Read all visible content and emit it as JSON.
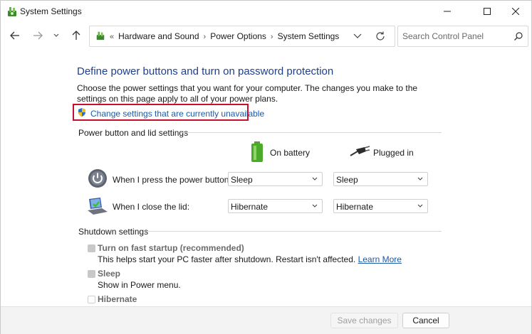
{
  "window": {
    "title": "System Settings"
  },
  "titlebar_icons": {
    "app": "control-panel-icon",
    "minimize": "minimize-icon",
    "maximize": "maximize-icon",
    "close": "close-icon"
  },
  "navigation": {
    "back_icon": "arrow-left-icon",
    "forward_icon": "arrow-right-icon",
    "recent_icon": "chevron-down-icon",
    "up_icon": "arrow-up-icon",
    "breadcrumbs": [
      "Hardware and Sound",
      "Power Options",
      "System Settings"
    ],
    "overflow": "«",
    "search_placeholder": "Search Control Panel"
  },
  "page": {
    "heading": "Define power buttons and turn on password protection",
    "description": "Choose the power settings that you want for your computer. The changes you make to the settings on this page apply to all of your power plans.",
    "change_link": "Change settings that are currently unavailable"
  },
  "power_button_section": {
    "label": "Power button and lid settings",
    "columns": [
      "On battery",
      "Plugged in"
    ],
    "rows": [
      {
        "label": "When I press the power button:",
        "on_battery": "Sleep",
        "plugged_in": "Sleep",
        "icon": "power-button-icon"
      },
      {
        "label": "When I close the lid:",
        "on_battery": "Hibernate",
        "plugged_in": "Hibernate",
        "icon": "laptop-lid-icon"
      }
    ]
  },
  "shutdown_section": {
    "label": "Shutdown settings",
    "options": [
      {
        "title": "Turn on fast startup (recommended)",
        "desc": "This helps start your PC faster after shutdown. Restart isn't affected.",
        "link": "Learn More",
        "checked": true
      },
      {
        "title": "Sleep",
        "desc": "Show in Power menu.",
        "checked": true
      },
      {
        "title": "Hibernate",
        "desc": "",
        "checked": false
      }
    ]
  },
  "footer": {
    "save_label": "Save changes",
    "cancel_label": "Cancel"
  },
  "colors": {
    "heading": "#1e3f8a",
    "link": "#1b5aa8",
    "highlight_box": "#c8102e"
  }
}
